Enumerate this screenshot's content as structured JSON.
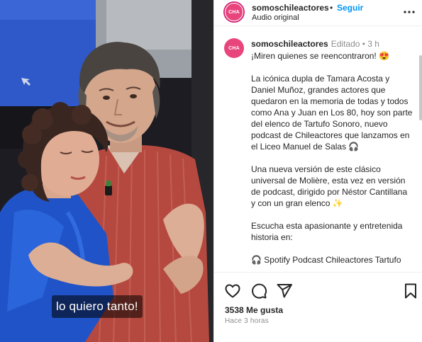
{
  "media": {
    "caption": "lo quiero tanto!"
  },
  "header": {
    "avatar_text": "CHA",
    "username": "somoschileactores",
    "separator": "•",
    "follow_label": "Seguir",
    "audio": "Audio original",
    "more_icon": "more-options-icon"
  },
  "comment": {
    "avatar_text": "CHA",
    "username": "somoschileactores",
    "meta": "Editado • 3 h",
    "paragraphs": [
      "¡Miren quienes se reencontraron! 😍",
      "La icónica dupla de Tamara Acosta y Daniel Muñoz, grandes actores que quedaron en la memoria de todas y todos como Ana y Juan en Los 80, hoy son parte del elenco de Tartufo Sonoro, nuevo podcast de Chileactores que lanzamos en el Liceo Manuel de Salas 🎧",
      "Una nueva versión de este clásico universal de Molière, esta vez en versión de podcast, dirigido por Néstor Cantillana y con un gran elenco ✨",
      "Escucha esta apasionante y entretenida historia en:",
      "🎧 Spotify Podcast Chileactores Tartufo"
    ]
  },
  "actions": {
    "like_icon": "heart-icon",
    "comment_icon": "comment-icon",
    "share_icon": "share-icon",
    "save_icon": "bookmark-icon",
    "likes": "3538 Me gusta",
    "time": "Hace 3 horas"
  },
  "colors": {
    "accent": "#0095f6",
    "brand": "#e8457c",
    "muted": "#8e8e8e"
  }
}
